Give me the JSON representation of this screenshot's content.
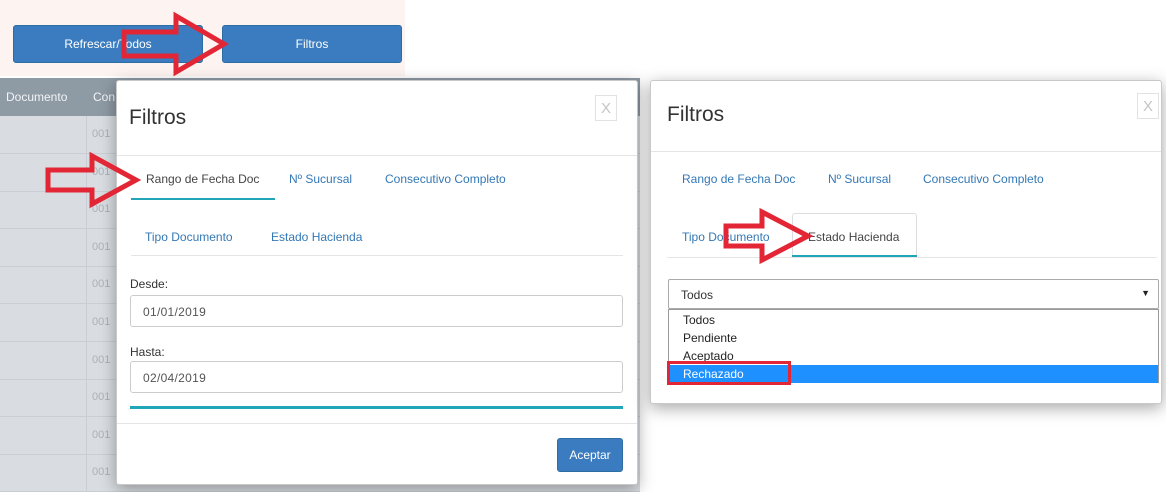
{
  "toolbar": {
    "refresh_label": "Refrescar/Todos",
    "filters_label": "Filtros"
  },
  "background_table": {
    "col_documento": "Documento",
    "col_con": "Con",
    "row_prefix": "001",
    "rows": 10
  },
  "modal_left": {
    "title": "Filtros",
    "close": "X",
    "tabs_row1": [
      "Rango de Fecha Doc",
      "Nº Sucursal",
      "Consecutivo Completo"
    ],
    "tabs_row2": [
      "Tipo Documento",
      "Estado Hacienda"
    ],
    "active_tab": "Rango de Fecha Doc",
    "desde_label": "Desde:",
    "desde_value": "01/01/2019",
    "hasta_label": "Hasta:",
    "hasta_value": "02/04/2019",
    "accept_label": "Aceptar"
  },
  "modal_right": {
    "title": "Filtros",
    "close": "X",
    "tabs_row1": [
      "Rango de Fecha Doc",
      "Nº Sucursal",
      "Consecutivo Completo"
    ],
    "tabs_row2": [
      "Tipo Documento",
      "Estado Hacienda"
    ],
    "active_tab": "Estado Hacienda",
    "select_value": "Todos",
    "options": [
      "Todos",
      "Pendiente",
      "Aceptado",
      "Rechazado"
    ],
    "highlighted_option": "Rechazado"
  },
  "colors": {
    "primary_button": "#3a7cbf",
    "tab_accent": "#20a6b8",
    "link": "#3478b5",
    "annotation_red": "#e32636",
    "option_selected": "#1e90ff"
  },
  "icons": [
    "close-icon",
    "caret-down-icon",
    "annotation-arrow"
  ]
}
